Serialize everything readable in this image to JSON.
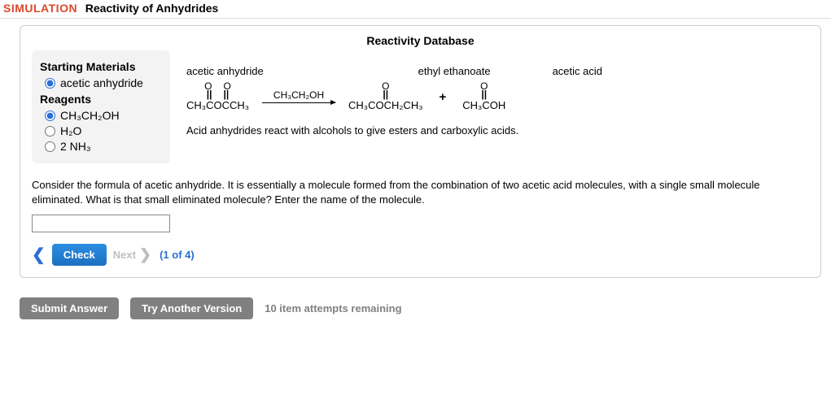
{
  "header": {
    "sim_label": "SIMULATION",
    "title": "Reactivity of Anhydrides"
  },
  "panel": {
    "db_title": "Reactivity Database",
    "left": {
      "head_start": "Starting Materials",
      "opt_start_1": "acetic anhydride",
      "head_reag": "Reagents",
      "opt_reag_1": "CH₃CH₂OH",
      "opt_reag_2": "H₂O",
      "opt_reag_3": "2 NH₃"
    },
    "rxn": {
      "label1": "acetic anhydride",
      "label2": "ethyl ethanoate",
      "label3": "acetic acid",
      "struct1_formula": "CH₃COCCH₃",
      "arrow_over": "CH₃CH₂OH",
      "struct2_formula": "CH₃COCH₂CH₃",
      "plus": "+",
      "struct3_formula": "CH₃COH",
      "o": "O",
      "bar": "||",
      "desc": "Acid anhydrides react with alcohols to give esters and carboxylic acids."
    },
    "question": "Consider the formula of acetic anhydride. It is essentially a molecule formed from the combination of two acetic acid molecules, with a single small molecule eliminated. What is that small eliminated molecule? Enter the name of the molecule.",
    "answer_value": "",
    "nav": {
      "check": "Check",
      "next": "Next",
      "counter": "(1 of 4)"
    }
  },
  "bottom": {
    "submit": "Submit Answer",
    "try": "Try Another Version",
    "attempts": "10 item attempts remaining"
  }
}
